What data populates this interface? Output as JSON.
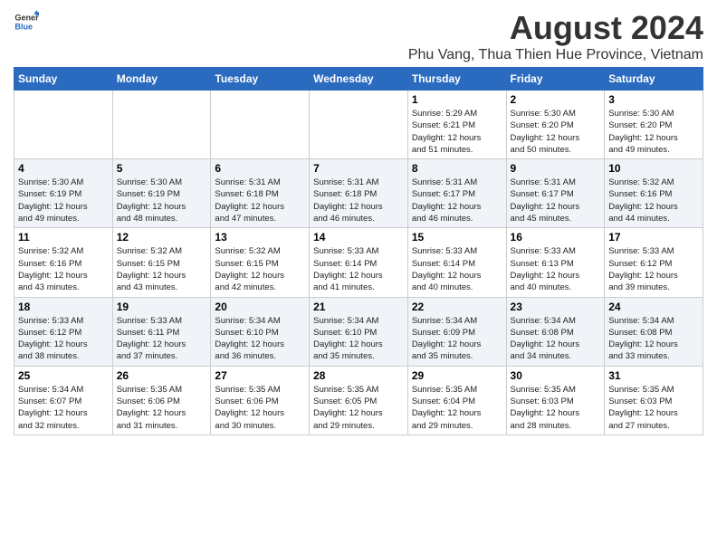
{
  "header": {
    "logo_general": "General",
    "logo_blue": "Blue",
    "title": "August 2024",
    "subtitle": "Phu Vang, Thua Thien Hue Province, Vietnam"
  },
  "calendar": {
    "days_of_week": [
      "Sunday",
      "Monday",
      "Tuesday",
      "Wednesday",
      "Thursday",
      "Friday",
      "Saturday"
    ],
    "weeks": [
      [
        {
          "day": "",
          "info": ""
        },
        {
          "day": "",
          "info": ""
        },
        {
          "day": "",
          "info": ""
        },
        {
          "day": "",
          "info": ""
        },
        {
          "day": "1",
          "info": "Sunrise: 5:29 AM\nSunset: 6:21 PM\nDaylight: 12 hours\nand 51 minutes."
        },
        {
          "day": "2",
          "info": "Sunrise: 5:30 AM\nSunset: 6:20 PM\nDaylight: 12 hours\nand 50 minutes."
        },
        {
          "day": "3",
          "info": "Sunrise: 5:30 AM\nSunset: 6:20 PM\nDaylight: 12 hours\nand 49 minutes."
        }
      ],
      [
        {
          "day": "4",
          "info": "Sunrise: 5:30 AM\nSunset: 6:19 PM\nDaylight: 12 hours\nand 49 minutes."
        },
        {
          "day": "5",
          "info": "Sunrise: 5:30 AM\nSunset: 6:19 PM\nDaylight: 12 hours\nand 48 minutes."
        },
        {
          "day": "6",
          "info": "Sunrise: 5:31 AM\nSunset: 6:18 PM\nDaylight: 12 hours\nand 47 minutes."
        },
        {
          "day": "7",
          "info": "Sunrise: 5:31 AM\nSunset: 6:18 PM\nDaylight: 12 hours\nand 46 minutes."
        },
        {
          "day": "8",
          "info": "Sunrise: 5:31 AM\nSunset: 6:17 PM\nDaylight: 12 hours\nand 46 minutes."
        },
        {
          "day": "9",
          "info": "Sunrise: 5:31 AM\nSunset: 6:17 PM\nDaylight: 12 hours\nand 45 minutes."
        },
        {
          "day": "10",
          "info": "Sunrise: 5:32 AM\nSunset: 6:16 PM\nDaylight: 12 hours\nand 44 minutes."
        }
      ],
      [
        {
          "day": "11",
          "info": "Sunrise: 5:32 AM\nSunset: 6:16 PM\nDaylight: 12 hours\nand 43 minutes."
        },
        {
          "day": "12",
          "info": "Sunrise: 5:32 AM\nSunset: 6:15 PM\nDaylight: 12 hours\nand 43 minutes."
        },
        {
          "day": "13",
          "info": "Sunrise: 5:32 AM\nSunset: 6:15 PM\nDaylight: 12 hours\nand 42 minutes."
        },
        {
          "day": "14",
          "info": "Sunrise: 5:33 AM\nSunset: 6:14 PM\nDaylight: 12 hours\nand 41 minutes."
        },
        {
          "day": "15",
          "info": "Sunrise: 5:33 AM\nSunset: 6:14 PM\nDaylight: 12 hours\nand 40 minutes."
        },
        {
          "day": "16",
          "info": "Sunrise: 5:33 AM\nSunset: 6:13 PM\nDaylight: 12 hours\nand 40 minutes."
        },
        {
          "day": "17",
          "info": "Sunrise: 5:33 AM\nSunset: 6:12 PM\nDaylight: 12 hours\nand 39 minutes."
        }
      ],
      [
        {
          "day": "18",
          "info": "Sunrise: 5:33 AM\nSunset: 6:12 PM\nDaylight: 12 hours\nand 38 minutes."
        },
        {
          "day": "19",
          "info": "Sunrise: 5:33 AM\nSunset: 6:11 PM\nDaylight: 12 hours\nand 37 minutes."
        },
        {
          "day": "20",
          "info": "Sunrise: 5:34 AM\nSunset: 6:10 PM\nDaylight: 12 hours\nand 36 minutes."
        },
        {
          "day": "21",
          "info": "Sunrise: 5:34 AM\nSunset: 6:10 PM\nDaylight: 12 hours\nand 35 minutes."
        },
        {
          "day": "22",
          "info": "Sunrise: 5:34 AM\nSunset: 6:09 PM\nDaylight: 12 hours\nand 35 minutes."
        },
        {
          "day": "23",
          "info": "Sunrise: 5:34 AM\nSunset: 6:08 PM\nDaylight: 12 hours\nand 34 minutes."
        },
        {
          "day": "24",
          "info": "Sunrise: 5:34 AM\nSunset: 6:08 PM\nDaylight: 12 hours\nand 33 minutes."
        }
      ],
      [
        {
          "day": "25",
          "info": "Sunrise: 5:34 AM\nSunset: 6:07 PM\nDaylight: 12 hours\nand 32 minutes."
        },
        {
          "day": "26",
          "info": "Sunrise: 5:35 AM\nSunset: 6:06 PM\nDaylight: 12 hours\nand 31 minutes."
        },
        {
          "day": "27",
          "info": "Sunrise: 5:35 AM\nSunset: 6:06 PM\nDaylight: 12 hours\nand 30 minutes."
        },
        {
          "day": "28",
          "info": "Sunrise: 5:35 AM\nSunset: 6:05 PM\nDaylight: 12 hours\nand 29 minutes."
        },
        {
          "day": "29",
          "info": "Sunrise: 5:35 AM\nSunset: 6:04 PM\nDaylight: 12 hours\nand 29 minutes."
        },
        {
          "day": "30",
          "info": "Sunrise: 5:35 AM\nSunset: 6:03 PM\nDaylight: 12 hours\nand 28 minutes."
        },
        {
          "day": "31",
          "info": "Sunrise: 5:35 AM\nSunset: 6:03 PM\nDaylight: 12 hours\nand 27 minutes."
        }
      ]
    ]
  }
}
